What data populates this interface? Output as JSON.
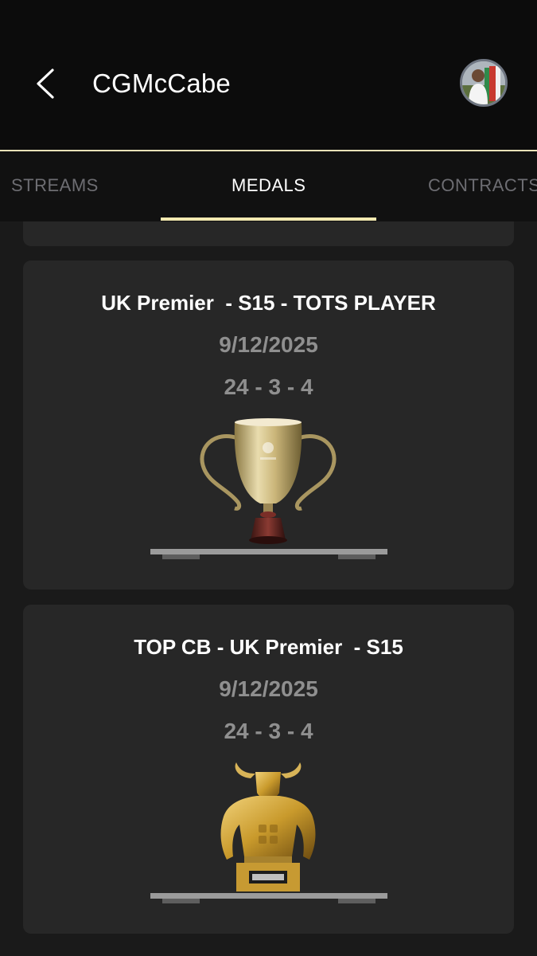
{
  "header": {
    "title": "CGMcCabe",
    "back_icon": "chevron-left-icon",
    "avatar_icon": "profile-avatar"
  },
  "tabs": [
    {
      "label": "STREAMS",
      "active": false
    },
    {
      "label": "MEDALS",
      "active": true
    },
    {
      "label": "CONTRACTS",
      "active": false
    }
  ],
  "colors": {
    "accent": "#f2e9b0",
    "header_bg": "#0c0c0c",
    "card_bg": "#272727",
    "page_bg": "#1a1a1a",
    "muted_text": "#8f8f8f"
  },
  "medals": [
    {
      "title": "UK Premier  - S15 - TOTS PLAYER",
      "date": "9/12/2025",
      "record": "24 - 3 - 4",
      "icon": "gold-cup-trophy-icon"
    },
    {
      "title": "TOP CB - UK Premier  - S15",
      "date": "9/12/2025",
      "record": "24 - 3 - 4",
      "icon": "golden-bull-trophy-icon"
    }
  ]
}
